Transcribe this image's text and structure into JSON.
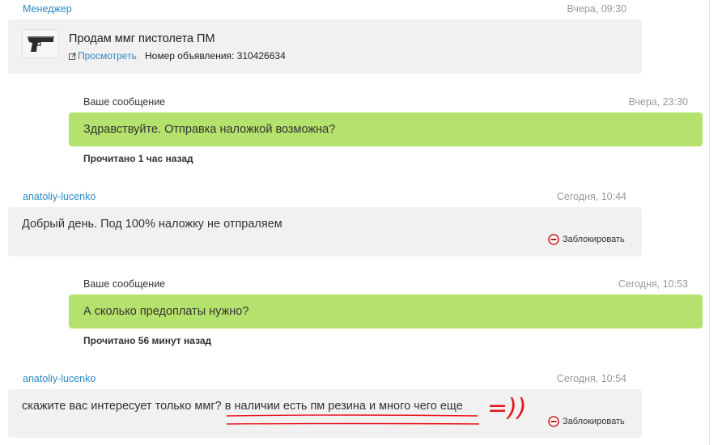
{
  "colors": {
    "link": "#2a8ac4",
    "incoming_bg": "#f1f1f1",
    "outgoing_bg": "#b5e26c",
    "timestamp": "#999999",
    "annotation": "#e8121b"
  },
  "messages": [
    {
      "author": "Менеджер",
      "time": "Вчера, 09:30",
      "ad": {
        "title": "Продам ммг пистолета ПМ",
        "view_label": "Просмотреть",
        "number_label": "Номер объявления: 310426634"
      }
    },
    {
      "label": "Ваше сообщение",
      "time": "Вчера, 23:30",
      "text": "Здравствуйте. Отправка наложкой возможна?",
      "read_status": "Прочитано 1 час назад"
    },
    {
      "author": "anatoliy-lucenko",
      "time": "Сегодня, 10:44",
      "text": "Добрый день. Под 100% наложку не отпраляем",
      "block_label": "Заблокировать"
    },
    {
      "label": "Ваше сообщение",
      "time": "Сегодня, 10:53",
      "text": "А сколько предоплаты нужно?",
      "read_status": "Прочитано 56 минут назад"
    },
    {
      "author": "anatoliy-lucenko",
      "time": "Сегодня, 10:54",
      "text_part1": "скажите вас интересует только ммг?",
      "text_part2": " в наличии есть пм резина и много чего еще",
      "block_label": "Заблокировать",
      "annotation": "=))"
    }
  ]
}
